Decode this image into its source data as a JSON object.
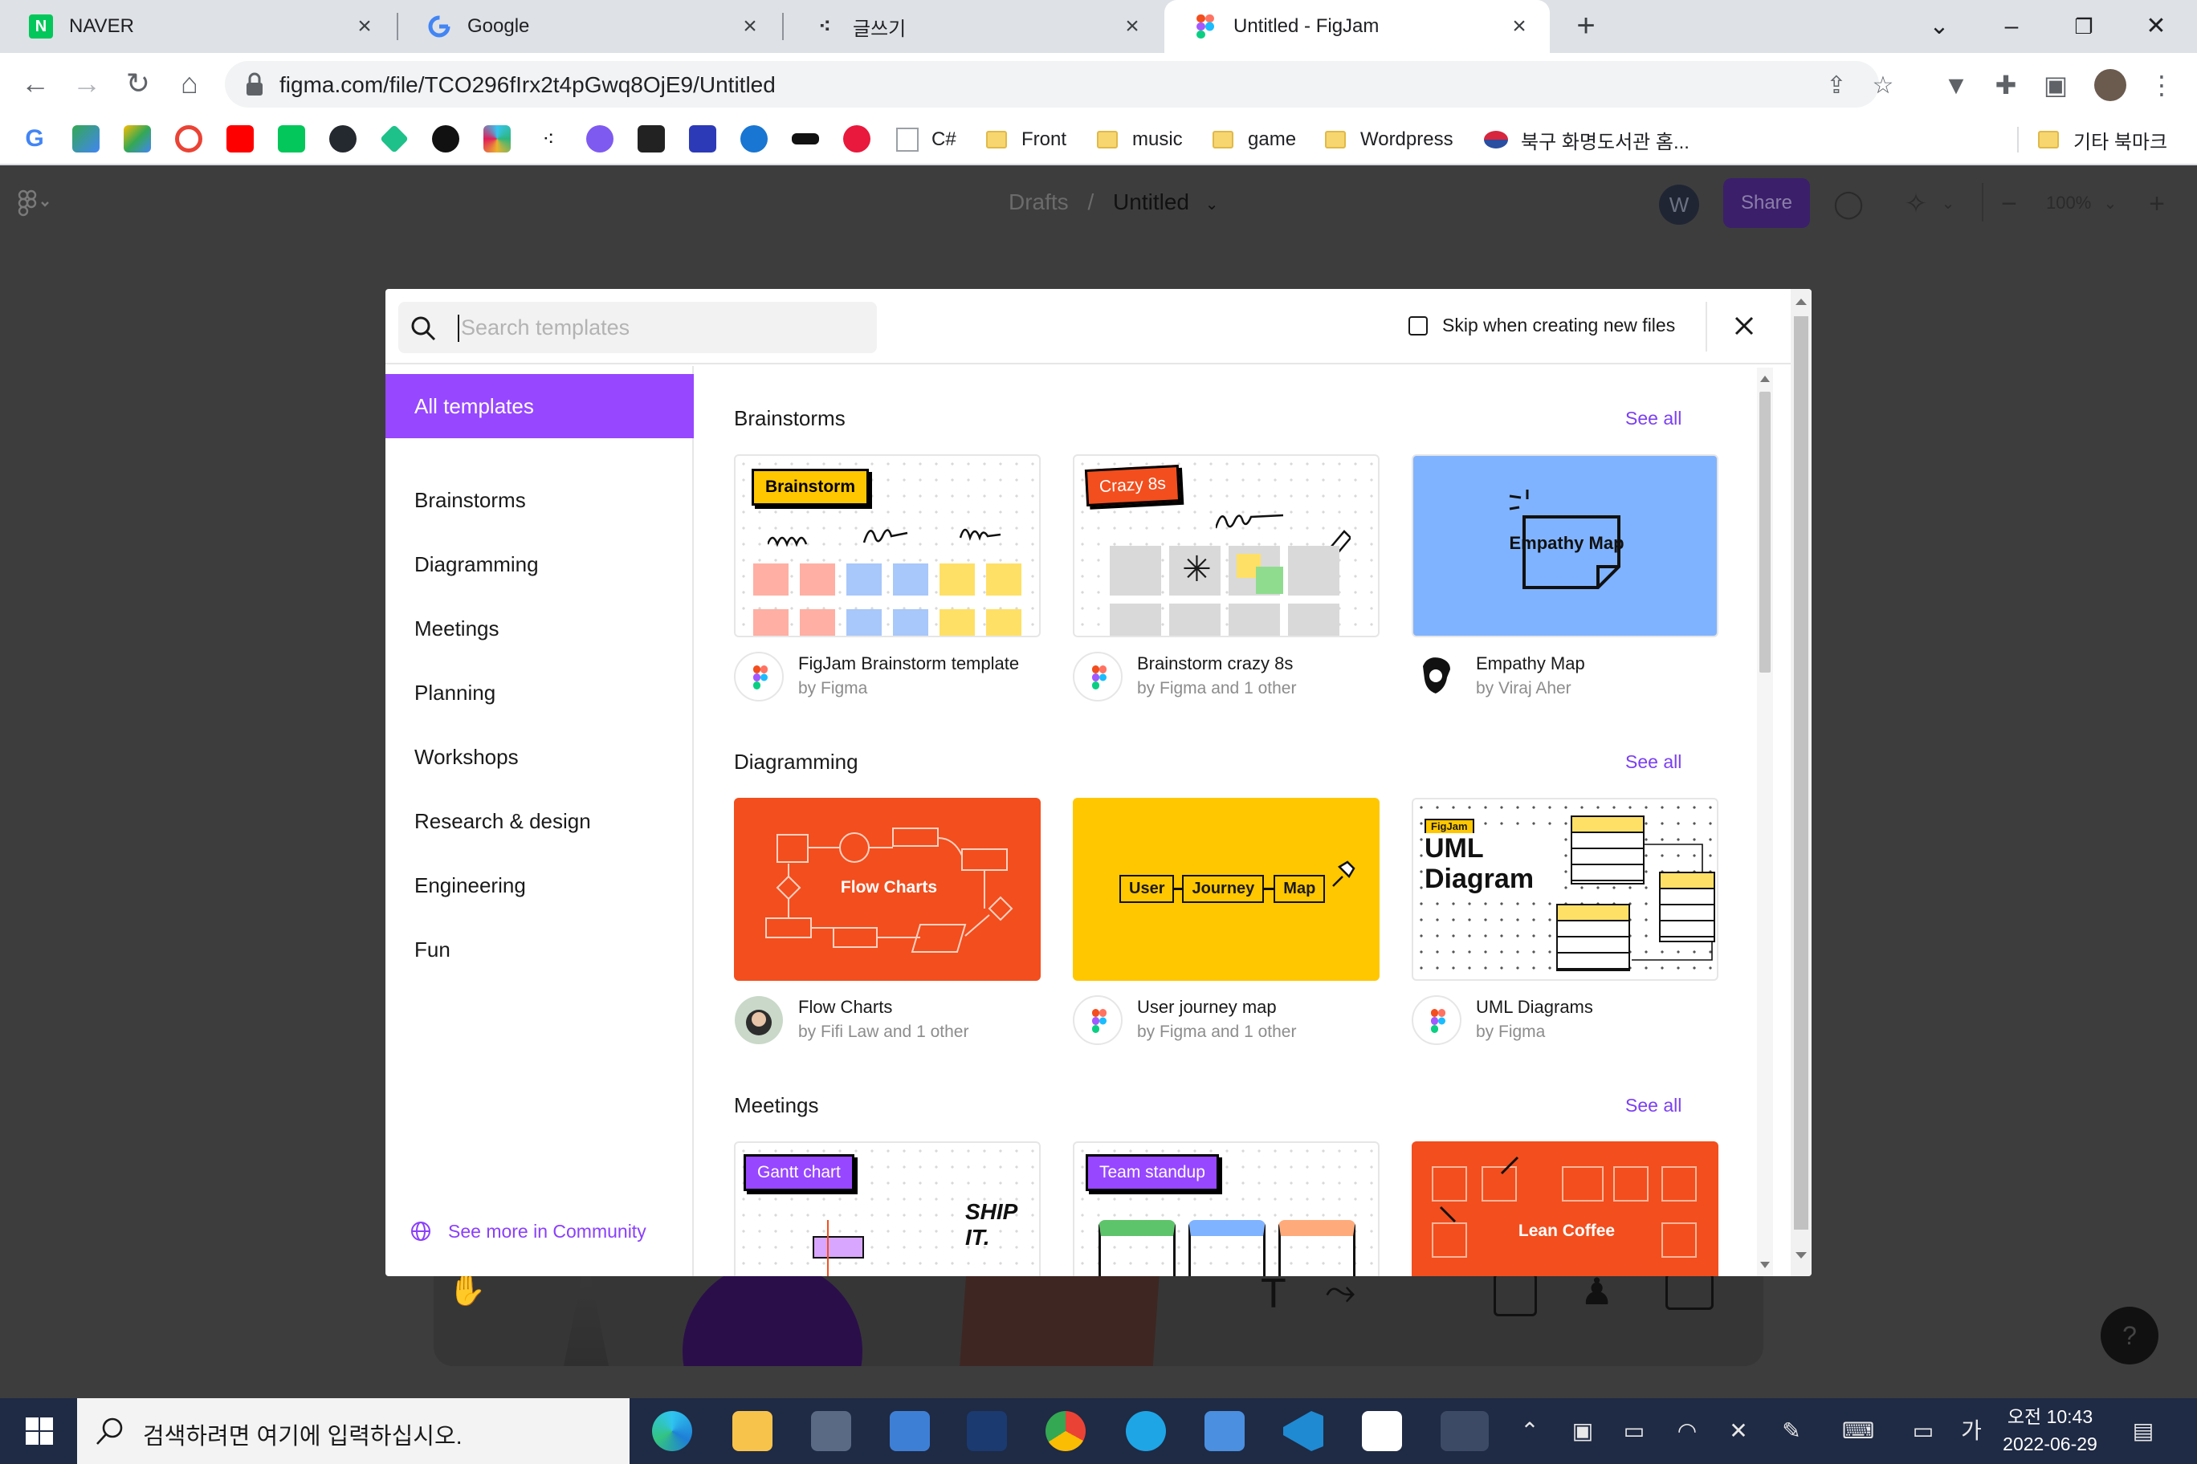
{
  "browser": {
    "tabs": [
      {
        "title": "NAVER",
        "icon": "naver-icon"
      },
      {
        "title": "Google",
        "icon": "google-icon"
      },
      {
        "title": "글쓰기",
        "icon": "dots-icon"
      },
      {
        "title": "Untitled - FigJam",
        "icon": "figma-icon"
      }
    ],
    "url": "figma.com/file/TCO296fIrx2t4pGwq8OjE9/Untitled",
    "bookmark_folders": [
      "C#",
      "Front",
      "music",
      "game",
      "Wordpress"
    ],
    "bookmark_link": "북구 화명도서관 홈...",
    "other_bookmarks": "기타 북마크"
  },
  "app": {
    "path_parent": "Drafts",
    "path_sep": "/",
    "file_name": "Untitled",
    "avatar_initial": "W",
    "share_label": "Share",
    "zoom": "100%",
    "help_label": "?"
  },
  "modal": {
    "search_placeholder": "Search templates",
    "skip_label": "Skip when creating new files",
    "sidebar": [
      "All templates",
      "Brainstorms",
      "Diagramming",
      "Meetings",
      "Planning",
      "Workshops",
      "Research & design",
      "Engineering",
      "Fun"
    ],
    "community_link": "See more in Community",
    "see_all": "See all",
    "sections": [
      {
        "title": "Brainstorms",
        "cards": [
          {
            "name": "FigJam Brainstorm template",
            "by": "by Figma",
            "thumb_label": "Brainstorm"
          },
          {
            "name": "Brainstorm crazy 8s",
            "by": "by Figma and 1 other",
            "thumb_label": "Crazy 8s"
          },
          {
            "name": "Empathy Map",
            "by": "by Viraj Aher",
            "thumb_label": "Empathy Map"
          }
        ]
      },
      {
        "title": "Diagramming",
        "cards": [
          {
            "name": "Flow Charts",
            "by": "by Fifi Law and 1 other",
            "thumb_label": "Flow Charts"
          },
          {
            "name": "User journey map",
            "by": "by Figma and 1 other",
            "thumb_labels": [
              "User",
              "Journey",
              "Map"
            ]
          },
          {
            "name": "UML Diagrams",
            "by": "by Figma",
            "thumb_label": "UML Diagram",
            "thumb_tag": "FigJam"
          }
        ]
      },
      {
        "title": "Meetings",
        "cards": [
          {
            "thumb_label": "Gantt chart",
            "thumb_text": "SHIP IT."
          },
          {
            "thumb_label": "Team standup"
          },
          {
            "thumb_label": "Lean Coffee"
          }
        ]
      }
    ]
  },
  "taskbar": {
    "search_placeholder": "검색하려면 여기에 입력하십시오.",
    "ime": "가",
    "time_period": "오전",
    "time": "10:43",
    "date": "2022-06-29"
  },
  "colors": {
    "accent_purple": "#9747ff",
    "link_purple": "#7b3ff2",
    "brainstorm_yellow": "#ffc700",
    "flow_orange": "#f24e1e",
    "empathy_blue": "#80b3ff"
  }
}
